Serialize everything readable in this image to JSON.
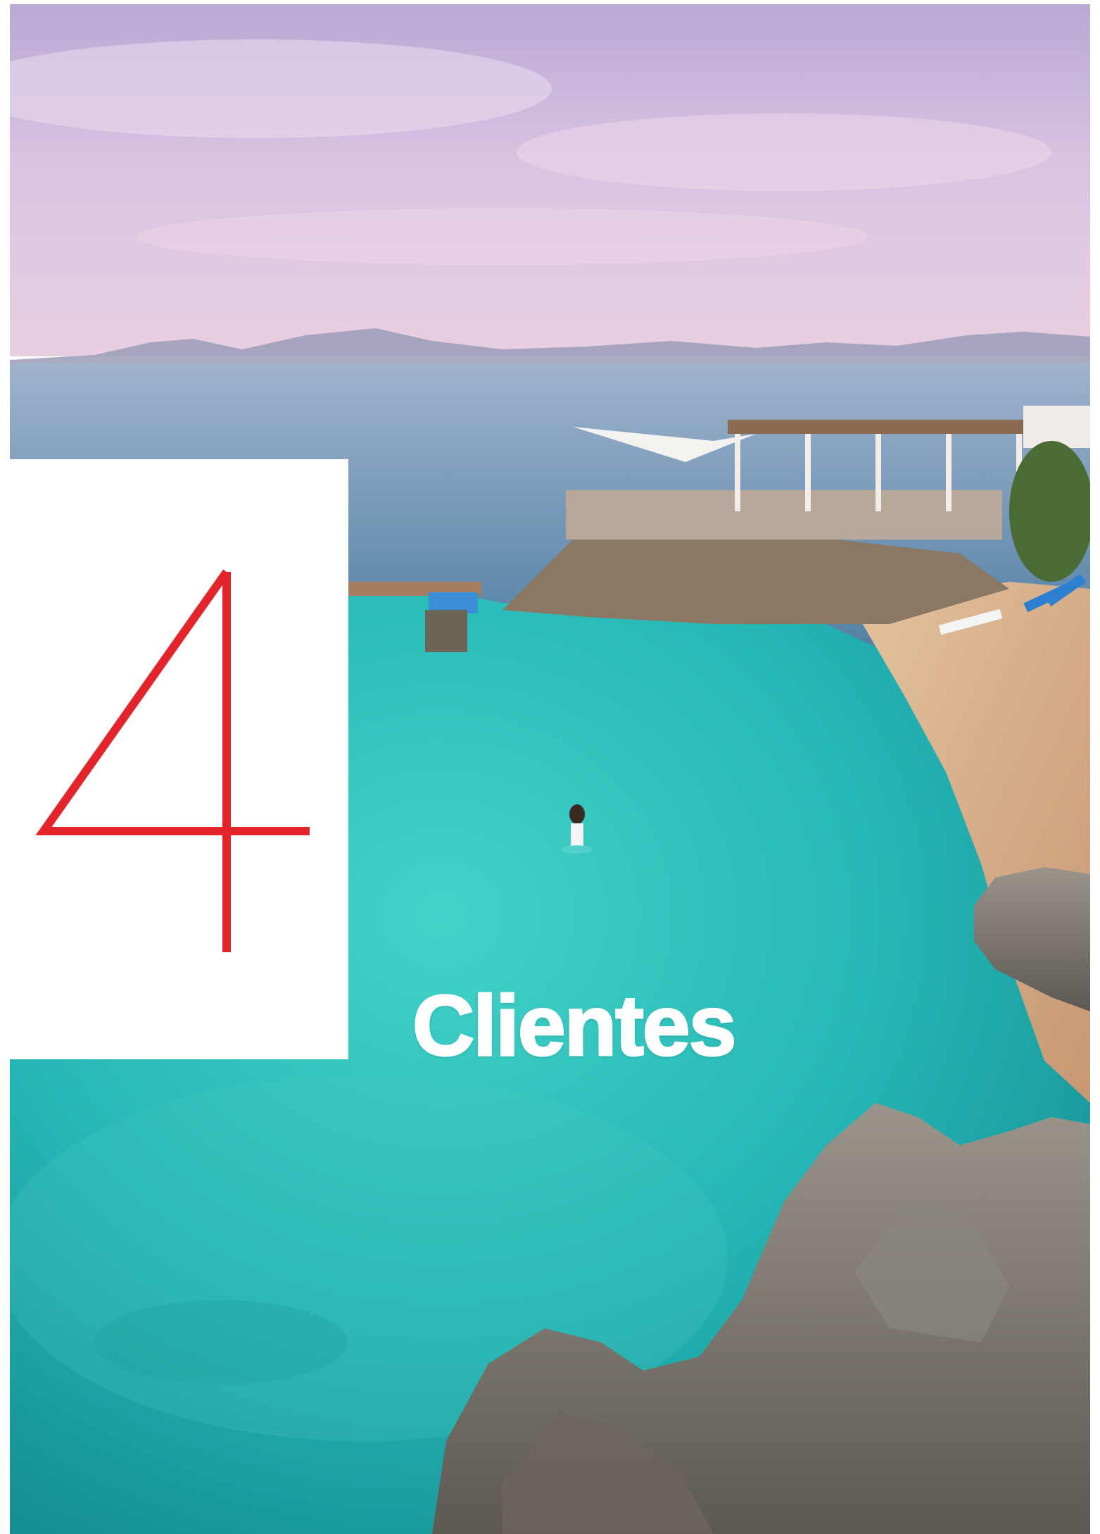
{
  "chapter": {
    "number": "4",
    "title": "Clientes"
  },
  "colors": {
    "accent": "#e3252b",
    "title_text": "#ffffff",
    "box_background": "#ffffff",
    "sky_top": "#c9b8dc",
    "sky_bottom": "#e3c8de",
    "sea_far": "#8aa6c4",
    "lagoon": "#2cc2c0",
    "lagoon_deep": "#1a9ea3",
    "beach": "#d9b08c",
    "rock": "#7d776f"
  },
  "photo": {
    "subject": "coastal-cove-photo"
  }
}
